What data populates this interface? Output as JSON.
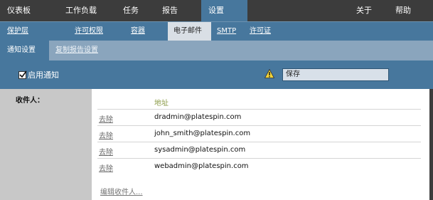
{
  "topnav": {
    "items": [
      "仪表板",
      "工作负载",
      "任务",
      "报告",
      "设置"
    ],
    "right": [
      "关于",
      "帮助"
    ]
  },
  "subnav": {
    "items": [
      "保护层",
      "许可权限",
      "容器",
      "电子邮件",
      "SMTP",
      "许可证"
    ]
  },
  "tabs": [
    "通知设置",
    "复制报告设置"
  ],
  "toolbar": {
    "enable_label": "启用通知",
    "enable_checked": true,
    "save_label": "保存"
  },
  "recipients": {
    "label": "收件人：",
    "column_header": "地址",
    "rows": [
      {
        "action": "去除",
        "email": "dradmin@platespin.com"
      },
      {
        "action": "去除",
        "email": "john_smith@platespin.com"
      },
      {
        "action": "去除",
        "email": "sysadmin@platespin.com"
      },
      {
        "action": "去除",
        "email": "webadmin@platespin.com"
      }
    ],
    "edit_label": "编辑收件人..."
  },
  "colors": {
    "top_bar": "#3c3c3c",
    "accent": "#47779d",
    "tab_bar": "#8aa5bd",
    "header_text": "#8a9a45"
  }
}
